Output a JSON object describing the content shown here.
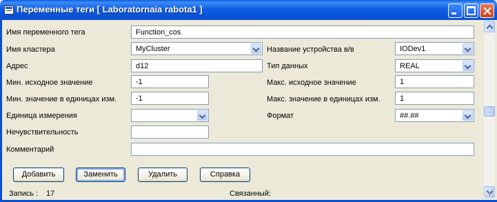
{
  "window": {
    "title": "Переменные теги [ Laboratornaia rabota1 ]"
  },
  "fields": {
    "tag_name": {
      "label": "Имя переменного тега",
      "value": "Function_cos"
    },
    "cluster": {
      "label": "Имя кластера",
      "value": "MyCluster"
    },
    "io_device": {
      "label": "Название устройства в/в",
      "value": "IODev1"
    },
    "address": {
      "label": "Адрес",
      "value": "d12"
    },
    "data_type": {
      "label": "Тип данных",
      "value": "REAL"
    },
    "raw_min": {
      "label": "Мин. исходное значение",
      "value": "-1"
    },
    "raw_max": {
      "label": "Макс. исходное значение",
      "value": "1"
    },
    "eng_min": {
      "label": "Мин. значение в единицах изм.",
      "value": "-1"
    },
    "eng_max": {
      "label": "Макс. значение в единицах изм.",
      "value": "1"
    },
    "eng_units": {
      "label": "Единица измерения",
      "value": ""
    },
    "format": {
      "label": "Формат",
      "value": "##.##"
    },
    "deadband": {
      "label": "Нечувствительность",
      "value": ""
    },
    "comment": {
      "label": "Комментарий",
      "value": ""
    }
  },
  "buttons": {
    "add": "Добавить",
    "replace": "Заменить",
    "delete": "Удалить",
    "help": "Справка"
  },
  "status": {
    "record_label": "Запись :",
    "record_value": "17",
    "linked_label": "Связанный:"
  },
  "colors": {
    "titlebar": "#0b4fcf",
    "dialog_bg": "#ece9d8",
    "field_border": "#7f9db9"
  }
}
